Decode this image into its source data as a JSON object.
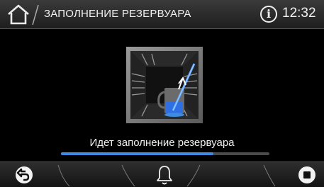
{
  "header": {
    "title": "ЗАПОЛНЕНИЕ РЕЗЕРВУАРА",
    "info_glyph": "i",
    "time": "12:32"
  },
  "main": {
    "status_text": "Идет заполнение резервуара",
    "progress_fraction": 0.73
  },
  "colors": {
    "accent": "#3d8be0",
    "water": "#2f6fe4"
  },
  "icons": [
    "home-icon",
    "info-icon",
    "refill-chamber-icon",
    "back-arrow-icon",
    "bell-icon",
    "stop-icon"
  ]
}
